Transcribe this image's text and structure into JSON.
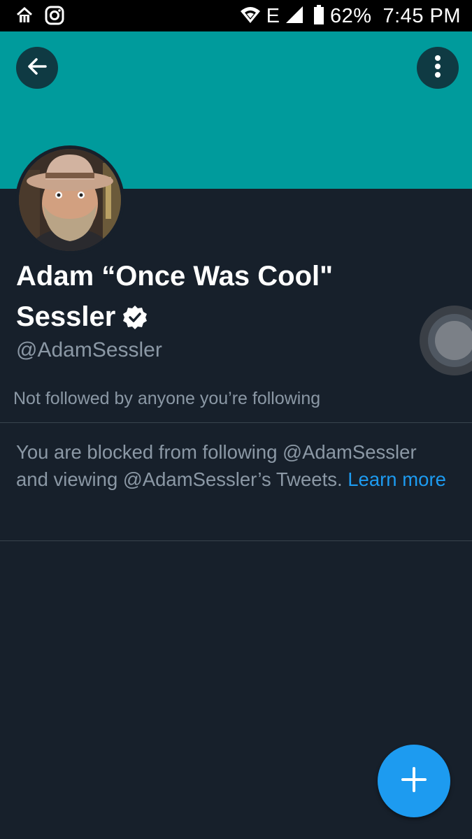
{
  "status_bar": {
    "network": "E",
    "battery": "62%",
    "time": "7:45 PM",
    "icons": [
      "home-app-icon",
      "instagram-icon",
      "wifi-icon",
      "signal-icon",
      "battery-icon"
    ]
  },
  "header": {
    "banner_color": "#009b9c",
    "back_icon": "arrow-left-icon",
    "more_icon": "more-vertical-icon"
  },
  "profile": {
    "name_line1": "Adam “Once Was Cool\"",
    "name_line2": "Sessler",
    "verified_icon": "verified-badge-icon",
    "handle": "@AdamSessler",
    "followed_by": "Not followed by anyone you’re following"
  },
  "blocked_notice": {
    "text": "You are blocked from following @AdamSessler and viewing @AdamSessler’s Tweets.",
    "link": "Learn more"
  },
  "fab": {
    "icon": "plus-icon",
    "color": "#1d9bf0"
  }
}
